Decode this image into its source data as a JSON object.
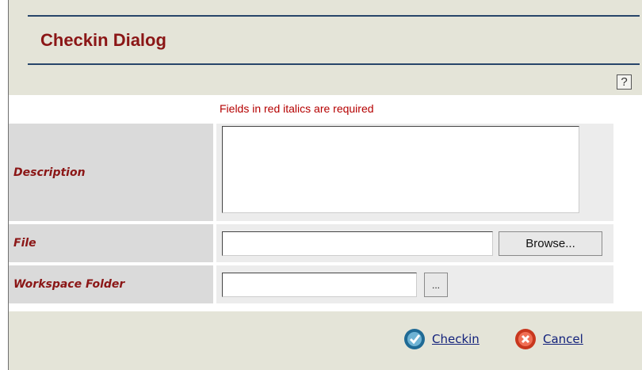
{
  "dialog": {
    "title": "Checkin Dialog",
    "help_label": "?",
    "required_note": "Fields in red italics are required"
  },
  "form": {
    "description": {
      "label": "Description",
      "value": ""
    },
    "file": {
      "label": "File",
      "value": "",
      "browse_label": "Browse..."
    },
    "workspace_folder": {
      "label": "Workspace Folder",
      "value": "",
      "picker_label": "..."
    }
  },
  "actions": {
    "checkin_label": "Checkin",
    "cancel_label": "Cancel"
  },
  "colors": {
    "title": "#8b1616",
    "required_label": "#8b1616",
    "link": "#12217b",
    "rule": "#27456a",
    "dialog_bg": "#e4e4d8"
  },
  "icons": {
    "help": "question-mark-icon",
    "checkin": "check-circle-icon",
    "cancel": "x-circle-icon"
  }
}
